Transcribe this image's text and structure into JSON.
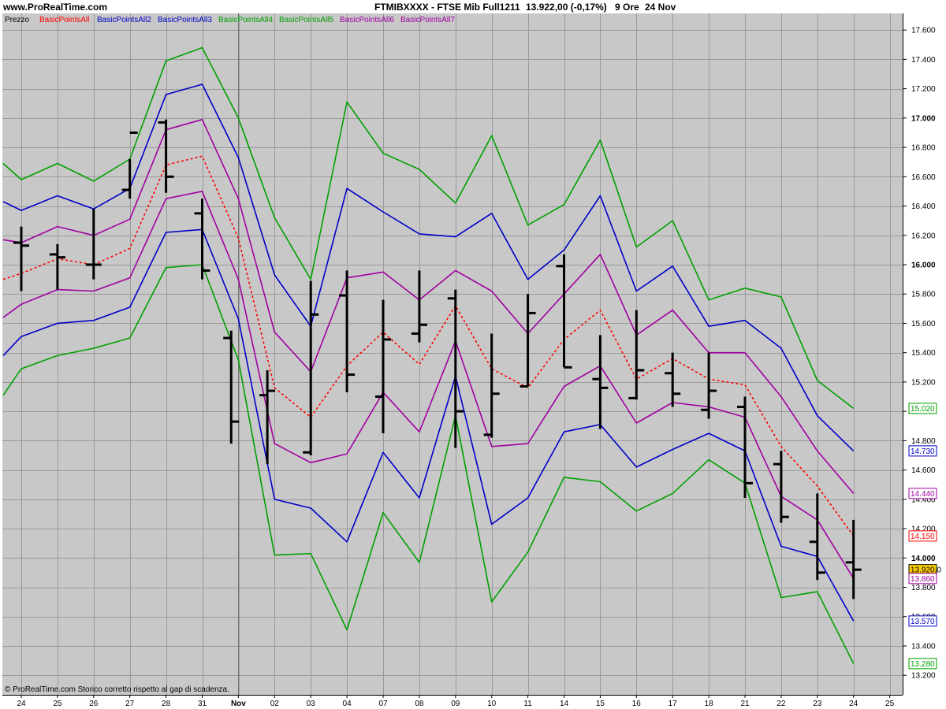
{
  "header": {
    "site": "www.ProRealTime.com",
    "title": "FTMIBXXXX - FTSE Mib Full1211",
    "price_info": "13.922,00 (-0,17%)",
    "period": "9 Ore",
    "date": "24 Nov"
  },
  "footer_note": "© ProRealTime.com  Storico corretto rispetto al gap di scadenza.",
  "colors": {
    "plot_bg": "#c8c8c8",
    "frame": "#ffffff",
    "grid": "#9a9a9a",
    "price_bars": "#000000",
    "green": "#00a000",
    "blue": "#0000c8",
    "purple": "#a000a0",
    "red": "#ff0000",
    "last_price_box": "#ffd000"
  },
  "chart_data": {
    "type": "line",
    "title": "FTMIBXXXX - FTSE Mib Full1211",
    "xlabel": "",
    "ylabel": "",
    "ylim": [
      13150,
      17700
    ],
    "y_ticks": [
      13200,
      13400,
      13600,
      13800,
      14000,
      14200,
      14400,
      14600,
      14800,
      15000,
      15200,
      15400,
      15600,
      15800,
      16000,
      16200,
      16400,
      16600,
      16800,
      17000,
      17200,
      17400,
      17600
    ],
    "y_tick_labels": [
      "13.200",
      "13.400",
      "13.600",
      "13.800",
      "14.000",
      "14.200",
      "14.400",
      "14.600",
      "14.800",
      "15.000",
      "15.200",
      "15.400",
      "15.600",
      "15.800",
      "16.000",
      "16.200",
      "16.400",
      "16.600",
      "16.800",
      "17.000",
      "17.200",
      "17.400",
      "17.600"
    ],
    "grid": true,
    "categories": [
      "24",
      "25",
      "26",
      "27",
      "28",
      "31",
      "Nov",
      "02",
      "03",
      "04",
      "07",
      "08",
      "09",
      "10",
      "11",
      "14",
      "15",
      "16",
      "17",
      "18",
      "21",
      "22",
      "23",
      "24",
      "25"
    ],
    "legend": [
      "Prezzo",
      "BasicPointsAll",
      "BasicPointsAll2",
      "BasicPointsAll3",
      "BasicPointsAll4",
      "BasicPointsAll5",
      "BasicPointsAll6",
      "BasicPointsAll7"
    ],
    "price_series": {
      "name": "Prezzo",
      "type": "ohlc",
      "bars": [
        {
          "i": 0,
          "o": 16150,
          "h": 16260,
          "l": 15820,
          "c": 16130
        },
        {
          "i": 1,
          "o": 16070,
          "h": 16140,
          "l": 15830,
          "c": 16050
        },
        {
          "i": 2,
          "o": 16000,
          "h": 16380,
          "l": 15900,
          "c": 16000
        },
        {
          "i": 3,
          "o": 16510,
          "h": 16720,
          "l": 16450,
          "c": 16900
        },
        {
          "i": 4,
          "o": 16970,
          "h": 16990,
          "l": 16490,
          "c": 16600
        },
        {
          "i": 5,
          "o": 16350,
          "h": 16450,
          "l": 15900,
          "c": 15960
        },
        {
          "i": 5.8,
          "o": 15500,
          "h": 15550,
          "l": 14780,
          "c": 14930
        },
        {
          "i": 6.8,
          "o": 15110,
          "h": 15280,
          "l": 14640,
          "c": 15140
        },
        {
          "i": 8,
          "o": 14720,
          "h": 15890,
          "l": 14700,
          "c": 15660
        },
        {
          "i": 9,
          "o": 15790,
          "h": 15960,
          "l": 15130,
          "c": 15250
        },
        {
          "i": 10,
          "o": 15100,
          "h": 15760,
          "l": 14850,
          "c": 15490
        },
        {
          "i": 11,
          "o": 15530,
          "h": 15960,
          "l": 15470,
          "c": 15590
        },
        {
          "i": 12,
          "o": 15770,
          "h": 15830,
          "l": 14750,
          "c": 15000
        },
        {
          "i": 13,
          "o": 14840,
          "h": 15530,
          "l": 14820,
          "c": 15120
        },
        {
          "i": 14,
          "o": 15170,
          "h": 15800,
          "l": 15170,
          "c": 15670
        },
        {
          "i": 15,
          "o": 15990,
          "h": 16070,
          "l": 15300,
          "c": 15300
        },
        {
          "i": 16,
          "o": 15220,
          "h": 15520,
          "l": 14880,
          "c": 15160
        },
        {
          "i": 17,
          "o": 15090,
          "h": 15690,
          "l": 15080,
          "c": 15280
        },
        {
          "i": 18,
          "o": 15260,
          "h": 15400,
          "l": 15030,
          "c": 15120
        },
        {
          "i": 19,
          "o": 15010,
          "h": 15400,
          "l": 14950,
          "c": 15140
        },
        {
          "i": 20,
          "o": 15030,
          "h": 15100,
          "l": 14410,
          "c": 14510
        },
        {
          "i": 21,
          "o": 14640,
          "h": 14730,
          "l": 14240,
          "c": 14280
        },
        {
          "i": 22,
          "o": 14110,
          "h": 14440,
          "l": 13850,
          "c": 13900
        },
        {
          "i": 23,
          "o": 13970,
          "h": 14260,
          "l": 13720,
          "c": 13920
        }
      ]
    },
    "series": [
      {
        "color": "#00a000",
        "dashed": false,
        "points": [
          [
            -0.5,
            16690
          ],
          [
            0,
            16580
          ],
          [
            1,
            16690
          ],
          [
            2,
            16570
          ],
          [
            3,
            16720
          ],
          [
            4,
            17390
          ],
          [
            5,
            17480
          ],
          [
            6,
            17000
          ],
          [
            7,
            16320
          ],
          [
            8,
            15900
          ],
          [
            9,
            17110
          ],
          [
            10,
            16760
          ],
          [
            11,
            16650
          ],
          [
            12,
            16420
          ],
          [
            13,
            16880
          ],
          [
            14,
            16270
          ],
          [
            15,
            16410
          ],
          [
            16,
            16850
          ],
          [
            17,
            16120
          ],
          [
            18,
            16300
          ],
          [
            19,
            15760
          ],
          [
            20,
            15840
          ],
          [
            21,
            15780
          ],
          [
            22,
            15210
          ],
          [
            23,
            15020
          ]
        ]
      },
      {
        "color": "#0000c8",
        "dashed": false,
        "points": [
          [
            -0.5,
            16430
          ],
          [
            0,
            16370
          ],
          [
            1,
            16470
          ],
          [
            2,
            16380
          ],
          [
            3,
            16520
          ],
          [
            4,
            17160
          ],
          [
            5,
            17230
          ],
          [
            6,
            16730
          ],
          [
            7,
            15930
          ],
          [
            8,
            15580
          ],
          [
            9,
            16520
          ],
          [
            10,
            16360
          ],
          [
            11,
            16210
          ],
          [
            12,
            16190
          ],
          [
            13,
            16350
          ],
          [
            14,
            15900
          ],
          [
            15,
            16100
          ],
          [
            16,
            16470
          ],
          [
            17,
            15820
          ],
          [
            18,
            15990
          ],
          [
            19,
            15580
          ],
          [
            20,
            15620
          ],
          [
            21,
            15430
          ],
          [
            22,
            14970
          ],
          [
            23,
            14730
          ]
        ]
      },
      {
        "color": "#a000a0",
        "dashed": false,
        "points": [
          [
            -0.5,
            16170
          ],
          [
            0,
            16150
          ],
          [
            1,
            16260
          ],
          [
            2,
            16200
          ],
          [
            3,
            16310
          ],
          [
            4,
            16920
          ],
          [
            5,
            16990
          ],
          [
            6,
            16450
          ],
          [
            7,
            15540
          ],
          [
            8,
            15270
          ],
          [
            9,
            15910
          ],
          [
            10,
            15950
          ],
          [
            11,
            15760
          ],
          [
            12,
            15960
          ],
          [
            13,
            15820
          ],
          [
            14,
            15530
          ],
          [
            15,
            15800
          ],
          [
            16,
            16070
          ],
          [
            17,
            15520
          ],
          [
            18,
            15690
          ],
          [
            19,
            15400
          ],
          [
            20,
            15400
          ],
          [
            21,
            15100
          ],
          [
            22,
            14730
          ],
          [
            23,
            14440
          ]
        ]
      },
      {
        "color": "#ff0000",
        "dashed": true,
        "points": [
          [
            -0.5,
            15900
          ],
          [
            0,
            15940
          ],
          [
            1,
            16040
          ],
          [
            2,
            16000
          ],
          [
            3,
            16110
          ],
          [
            4,
            16680
          ],
          [
            5,
            16740
          ],
          [
            6,
            16180
          ],
          [
            7,
            15160
          ],
          [
            8,
            14960
          ],
          [
            9,
            15310
          ],
          [
            10,
            15540
          ],
          [
            11,
            15320
          ],
          [
            12,
            15720
          ],
          [
            13,
            15290
          ],
          [
            14,
            15160
          ],
          [
            15,
            15490
          ],
          [
            16,
            15690
          ],
          [
            17,
            15220
          ],
          [
            18,
            15360
          ],
          [
            19,
            15220
          ],
          [
            20,
            15180
          ],
          [
            21,
            14760
          ],
          [
            22,
            14490
          ],
          [
            23,
            14150
          ]
        ]
      },
      {
        "color": "#a000a0",
        "dashed": false,
        "points": [
          [
            -0.5,
            15640
          ],
          [
            0,
            15730
          ],
          [
            1,
            15830
          ],
          [
            2,
            15820
          ],
          [
            3,
            15910
          ],
          [
            4,
            16450
          ],
          [
            5,
            16500
          ],
          [
            6,
            15900
          ],
          [
            7,
            14780
          ],
          [
            8,
            14650
          ],
          [
            9,
            14710
          ],
          [
            10,
            15130
          ],
          [
            11,
            14860
          ],
          [
            12,
            15480
          ],
          [
            13,
            14760
          ],
          [
            14,
            14780
          ],
          [
            15,
            15170
          ],
          [
            16,
            15310
          ],
          [
            17,
            14920
          ],
          [
            18,
            15060
          ],
          [
            19,
            15030
          ],
          [
            20,
            14960
          ],
          [
            21,
            14420
          ],
          [
            22,
            14260
          ],
          [
            23,
            13860
          ]
        ]
      },
      {
        "color": "#0000c8",
        "dashed": false,
        "points": [
          [
            -0.5,
            15380
          ],
          [
            0,
            15510
          ],
          [
            1,
            15600
          ],
          [
            2,
            15620
          ],
          [
            3,
            15710
          ],
          [
            4,
            16220
          ],
          [
            5,
            16240
          ],
          [
            6,
            15630
          ],
          [
            7,
            14400
          ],
          [
            8,
            14340
          ],
          [
            9,
            14110
          ],
          [
            10,
            14720
          ],
          [
            11,
            14410
          ],
          [
            12,
            15240
          ],
          [
            13,
            14230
          ],
          [
            14,
            14410
          ],
          [
            15,
            14860
          ],
          [
            16,
            14910
          ],
          [
            17,
            14620
          ],
          [
            18,
            14740
          ],
          [
            19,
            14850
          ],
          [
            20,
            14730
          ],
          [
            21,
            14080
          ],
          [
            22,
            14010
          ],
          [
            23,
            13570
          ]
        ]
      },
      {
        "color": "#00a000",
        "dashed": false,
        "points": [
          [
            -0.5,
            15110
          ],
          [
            0,
            15290
          ],
          [
            1,
            15380
          ],
          [
            2,
            15430
          ],
          [
            3,
            15500
          ],
          [
            4,
            15980
          ],
          [
            5,
            16000
          ],
          [
            6,
            15350
          ],
          [
            7,
            14020
          ],
          [
            8,
            14030
          ],
          [
            9,
            13510
          ],
          [
            10,
            14310
          ],
          [
            11,
            13970
          ],
          [
            12,
            14970
          ],
          [
            13,
            13700
          ],
          [
            14,
            14040
          ],
          [
            15,
            14550
          ],
          [
            16,
            14520
          ],
          [
            17,
            14320
          ],
          [
            18,
            14440
          ],
          [
            19,
            14670
          ],
          [
            20,
            14510
          ],
          [
            21,
            13730
          ],
          [
            22,
            13770
          ],
          [
            23,
            13280
          ]
        ]
      }
    ],
    "value_boxes": [
      {
        "label": "15.020",
        "value": 15020,
        "color": "#00a000",
        "fill": "#ffffff"
      },
      {
        "label": "14.730",
        "value": 14730,
        "color": "#0000c8",
        "fill": "#ffffff"
      },
      {
        "label": "14.440",
        "value": 14440,
        "color": "#a000a0",
        "fill": "#ffffff"
      },
      {
        "label": "14.150",
        "value": 14150,
        "color": "#ff0000",
        "fill": "#ffffff"
      },
      {
        "label": "13.920,0",
        "value": 13920,
        "color": "#000000",
        "fill": "#ffd000"
      },
      {
        "label": "13.860",
        "value": 13860,
        "color": "#a000a0",
        "fill": "#ffffff"
      },
      {
        "label": "13.570",
        "value": 13570,
        "color": "#0000c8",
        "fill": "#ffffff"
      },
      {
        "label": "13.280",
        "value": 13280,
        "color": "#00a000",
        "fill": "#ffffff"
      }
    ]
  }
}
